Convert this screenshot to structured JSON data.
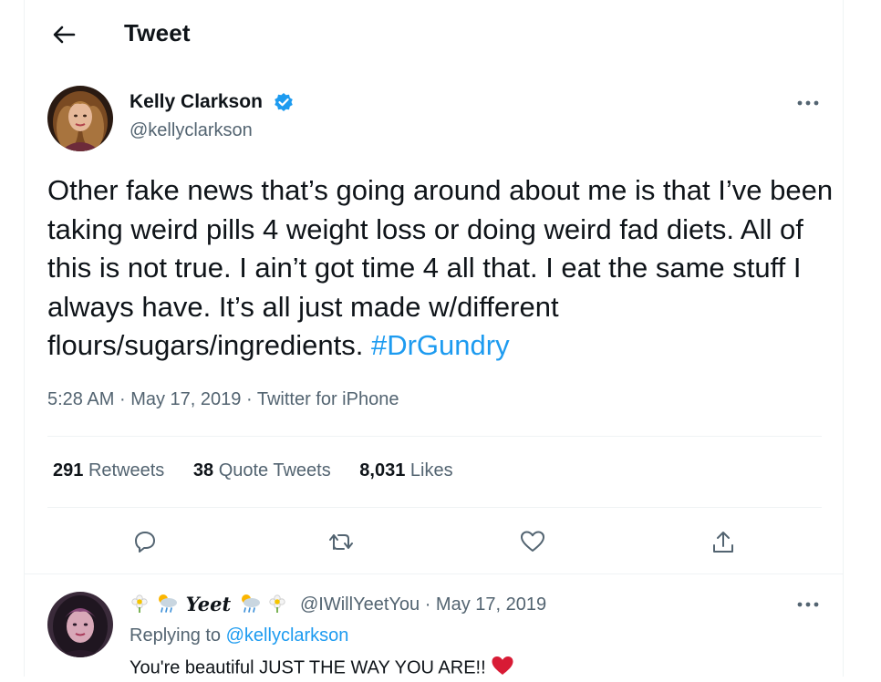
{
  "header": {
    "title": "Tweet"
  },
  "tweet": {
    "author_name": "Kelly Clarkson",
    "author_handle": "@kellyclarkson",
    "text": "Other fake news that’s going around about me is that I’ve been taking weird pills 4 weight loss or doing weird fad diets. All of this is not true. I ain’t got time 4 all that. I eat the same stuff I always have. It’s all just made w/different flours/sugars/ingredients.",
    "hashtag": "#DrGundry",
    "time": "5:28 AM",
    "date": "May 17, 2019",
    "source": "Twitter for iPhone",
    "separator": "·",
    "stats": {
      "retweets_count": "291",
      "retweets_label": "Retweets",
      "quotes_count": "38",
      "quotes_label": "Quote Tweets",
      "likes_count": "8,031",
      "likes_label": "Likes"
    }
  },
  "reply": {
    "display_name": "Yeet",
    "handle": "@IWillYeetYou",
    "date": "May 17, 2019",
    "replying_prefix": "Replying to",
    "replying_to": "@kellyclarkson",
    "text": "You're beautiful JUST THE WAY YOU ARE!!",
    "name_emojis": [
      "daisy-emoji",
      "sun-behind-rain-emoji"
    ]
  },
  "colors": {
    "accent": "#1d9bf0",
    "text_primary": "#0f1419",
    "text_secondary": "#536471",
    "divider": "#eff3f4",
    "heart_emoji": "#d81b35"
  },
  "icons": {
    "back": "arrow-left-icon",
    "verified": "verified-badge-icon",
    "more": "more-horizontal-icon",
    "reply": "reply-icon",
    "retweet": "retweet-icon",
    "like": "heart-icon",
    "share": "share-icon"
  }
}
